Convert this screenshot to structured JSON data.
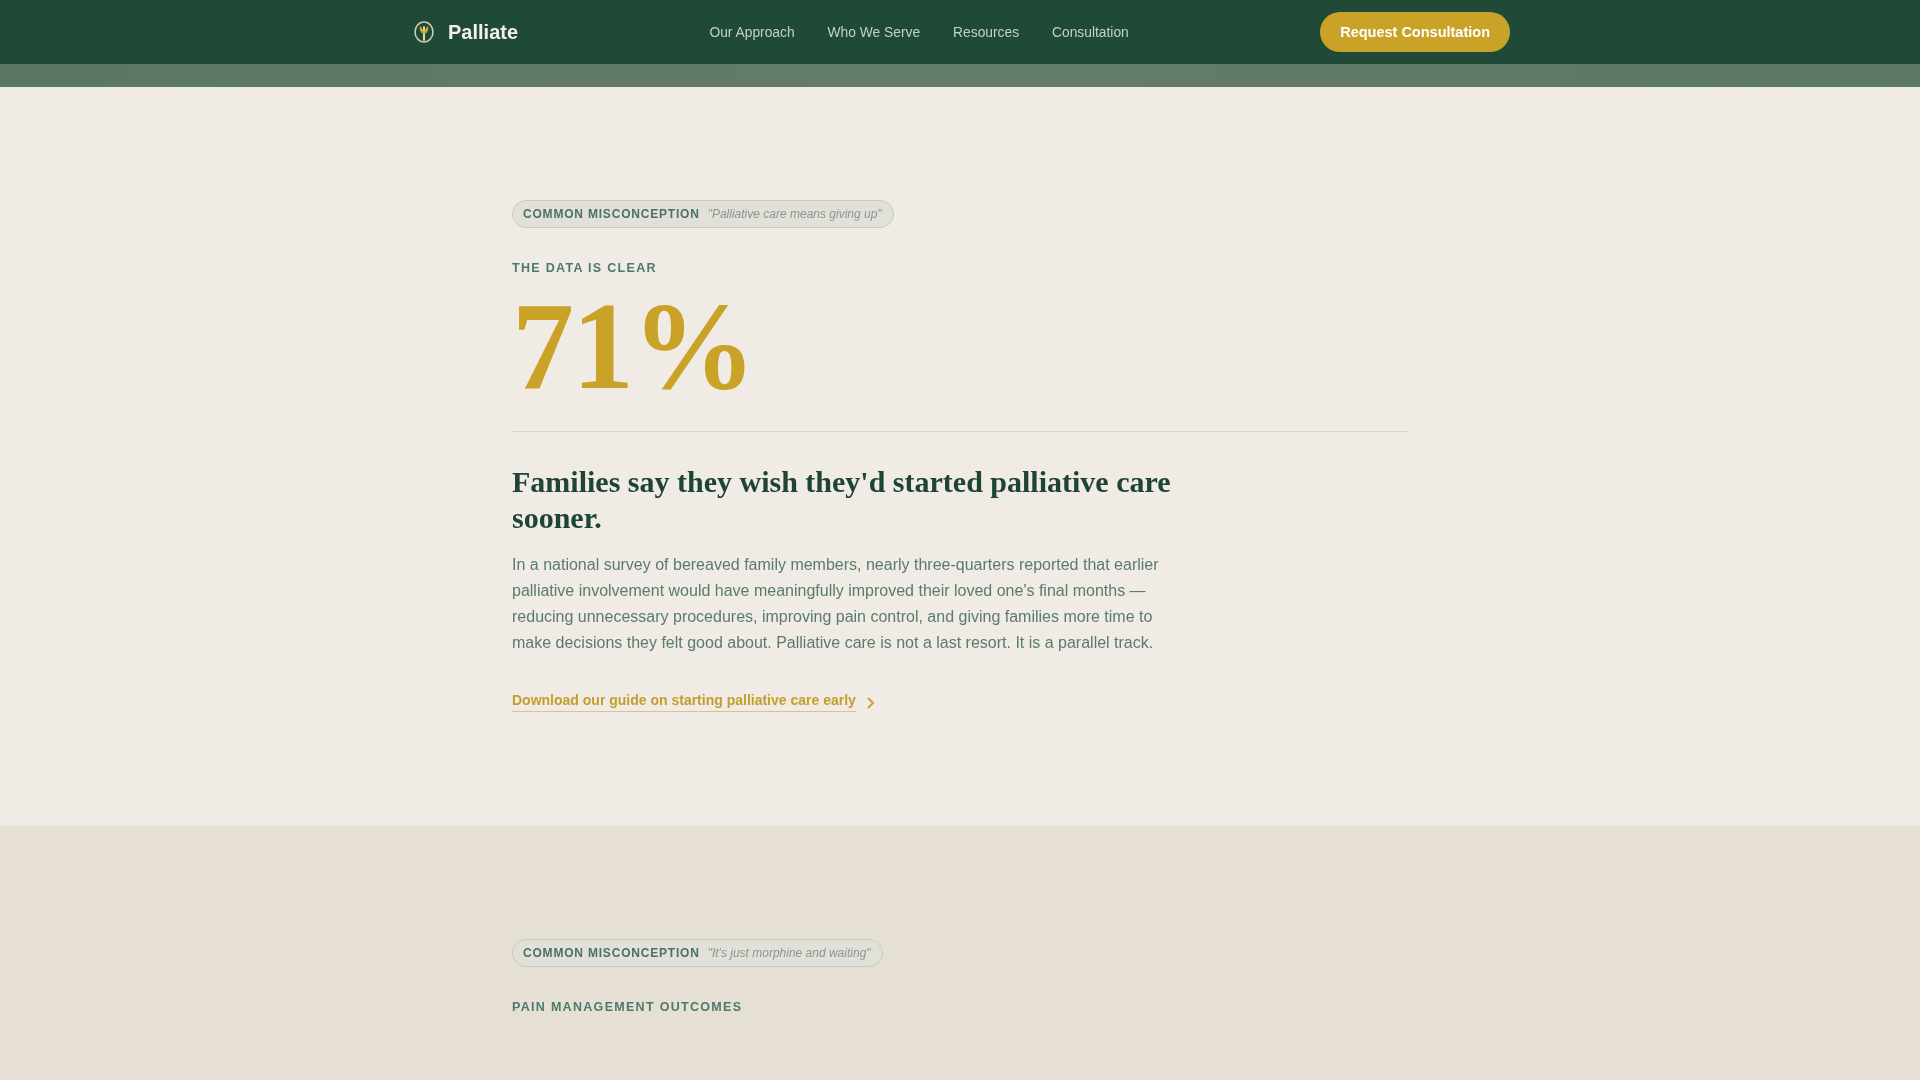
{
  "nav": {
    "brand": "Palliate",
    "links": [
      {
        "label": "Our Approach"
      },
      {
        "label": "Who We Serve"
      },
      {
        "label": "Resources"
      },
      {
        "label": "Consultation"
      }
    ],
    "cta": "Request Consultation"
  },
  "sections": [
    {
      "misconception_label": "COMMON MISCONCEPTION",
      "misconception_quote": "\"Palliative care means giving up\"",
      "eyebrow": "THE DATA IS CLEAR",
      "stat": "71%",
      "headline": "Families say they wish they'd started palliative care sooner.",
      "body": "In a national survey of bereaved family members, nearly three-quarters reported that earlier palliative involvement would have meaningfully improved their loved one's final months — reducing unnecessary procedures, improving pain control, and giving families more time to make decisions they felt good about. Palliative care is not a last resort. It is a parallel track.",
      "link": "Download our guide on starting palliative care early"
    },
    {
      "misconception_label": "COMMON MISCONCEPTION",
      "misconception_quote": "\"It's just morphine and waiting\"",
      "eyebrow": "PAIN MANAGEMENT OUTCOMES"
    }
  ]
}
